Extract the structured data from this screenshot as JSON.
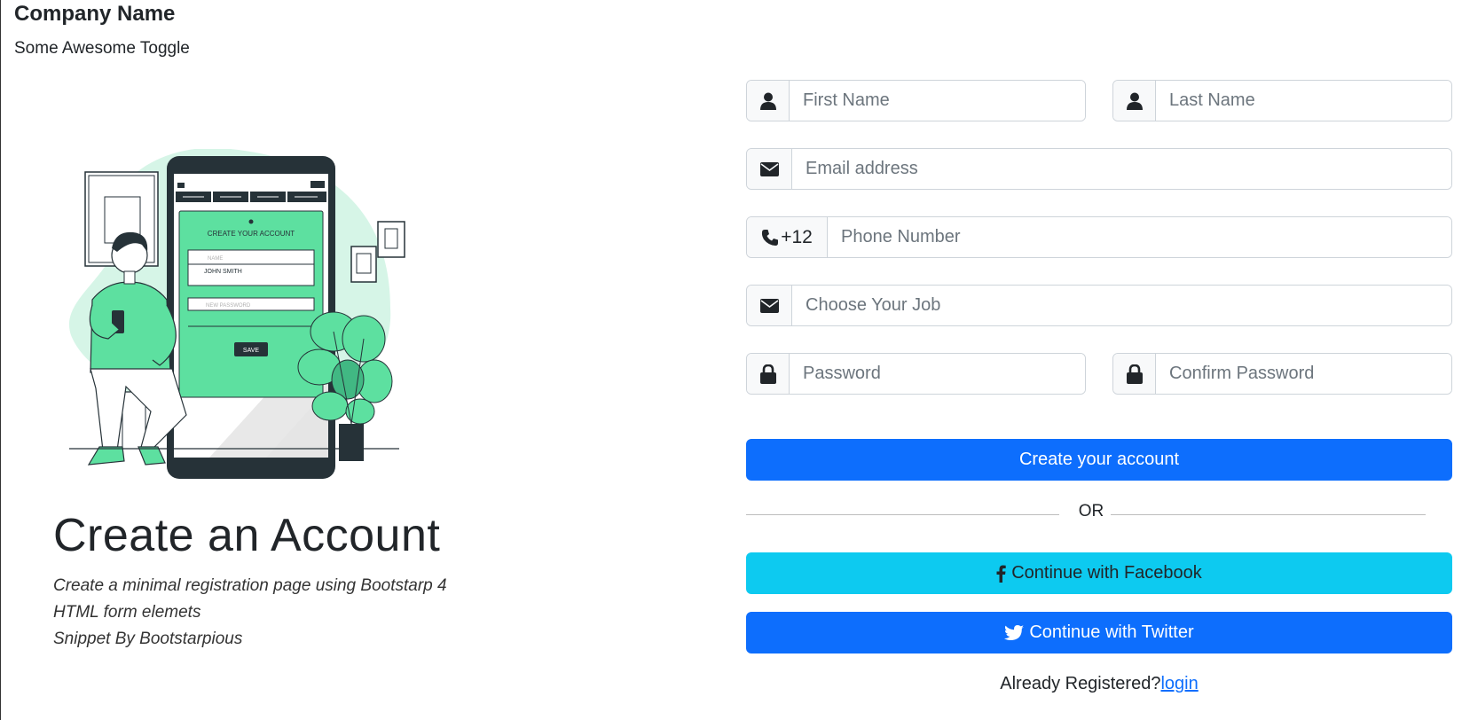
{
  "header": {
    "brand": "Company Name",
    "toggle": "Some Awesome Toggle"
  },
  "illustration": {
    "screen_heading": "CREATE YOUR ACCOUNT",
    "field_name": "NAME",
    "field_value": "JOHN SMITH",
    "field_password": "NEW PASSWORD",
    "save_label": "SAVE"
  },
  "hero": {
    "title": "Create an Account",
    "lines": [
      "Create a minimal registration page using Bootstarp 4",
      "HTML form elemets",
      "Snippet By Bootstarpious"
    ]
  },
  "form": {
    "first_name_placeholder": "First Name",
    "last_name_placeholder": "Last Name",
    "email_placeholder": "Email address",
    "phone_prefix": "+12",
    "phone_placeholder": "Phone Number",
    "job_placeholder": "Choose Your Job",
    "password_placeholder": "Password",
    "confirm_password_placeholder": "Confirm Password",
    "submit_label": "Create your account",
    "or_label": "OR",
    "facebook_label": "Continue with Facebook",
    "twitter_label": "Continue with Twitter",
    "already_registered": "Already Registered?",
    "login_label": "login"
  },
  "icons": {
    "user": "user-icon",
    "envelope": "envelope-icon",
    "phone": "phone-icon",
    "lock": "lock-icon",
    "facebook": "facebook-icon",
    "twitter": "twitter-icon"
  },
  "colors": {
    "primary": "#0d6efd",
    "info": "#0dcaf0",
    "accent_green": "#5de0a0",
    "light_green": "#d6f5e7",
    "dark": "#263238"
  }
}
